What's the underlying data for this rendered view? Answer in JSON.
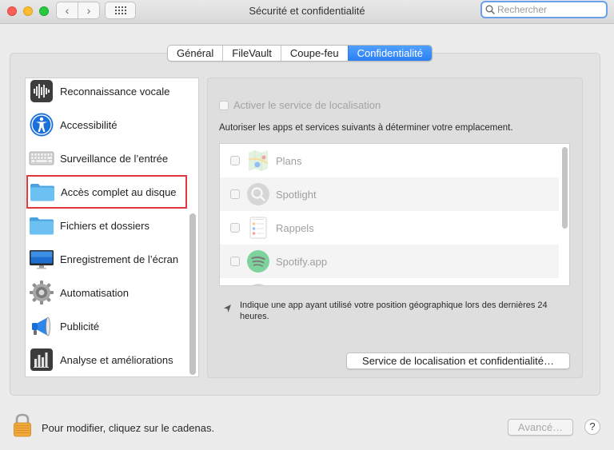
{
  "window": {
    "title": "Sécurité et confidentialité"
  },
  "toolbar": {
    "back_glyph": "‹",
    "forward_glyph": "›",
    "search_placeholder": "Rechercher"
  },
  "tabs": [
    {
      "label": "Général",
      "active": false
    },
    {
      "label": "FileVault",
      "active": false
    },
    {
      "label": "Coupe-feu",
      "active": false
    },
    {
      "label": "Confidentialité",
      "active": true
    }
  ],
  "sidebar": {
    "items": [
      {
        "label": "Reconnaissance vocale",
        "icon": "waveform-icon"
      },
      {
        "label": "Accessibilité",
        "icon": "accessibility-icon"
      },
      {
        "label": "Surveillance de l’entrée",
        "icon": "keyboard-icon"
      },
      {
        "label": "Accès complet au disque",
        "icon": "folder-icon",
        "selected": true
      },
      {
        "label": "Fichiers et dossiers",
        "icon": "folder-icon"
      },
      {
        "label": "Enregistrement de l’écran",
        "icon": "display-icon"
      },
      {
        "label": "Automatisation",
        "icon": "gear-icon"
      },
      {
        "label": "Publicité",
        "icon": "megaphone-icon"
      },
      {
        "label": "Analyse et améliorations",
        "icon": "bar-chart-icon"
      }
    ]
  },
  "location": {
    "enable_label": "Activer le service de localisation",
    "enabled": false,
    "description": "Autoriser les apps et services suivants à déterminer votre emplacement.",
    "apps": [
      {
        "name": "Plans",
        "icon": "maps-icon"
      },
      {
        "name": "Spotlight",
        "icon": "spotlight-icon"
      },
      {
        "name": "Rappels",
        "icon": "reminders-icon"
      },
      {
        "name": "Spotify.app",
        "icon": "spotify-icon"
      }
    ],
    "note": "Indique une app ayant utilisé votre position géographique lors des dernières 24 heures.",
    "details_button": "Service de localisation et confidentialité…"
  },
  "footer": {
    "lock_text": "Pour modifier, cliquez sur le cadenas.",
    "advanced_button": "Avancé…",
    "help_label": "?"
  },
  "colors": {
    "accent": "#2c7ff2",
    "selection_outline": "#e0383e",
    "folder": "#5fb6ee"
  }
}
